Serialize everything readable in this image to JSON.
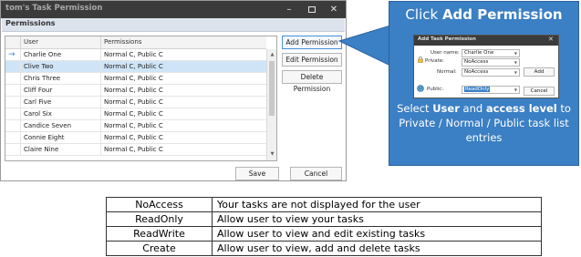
{
  "window": {
    "title": "tom's Task Permission",
    "minimize_glyph": "–",
    "close_glyph": "✕"
  },
  "group": {
    "label": "Permissions"
  },
  "grid": {
    "columns": [
      "User",
      "Permissions"
    ],
    "rows": [
      {
        "user": "Charlie One",
        "permissions": "Normal C, Public C",
        "current": true
      },
      {
        "user": "Clive Two",
        "permissions": "Normal C, Public C",
        "selected": true
      },
      {
        "user": "Chris Three",
        "permissions": "Normal C, Public C"
      },
      {
        "user": "Cliff Four",
        "permissions": "Normal C, Public C"
      },
      {
        "user": "Carl Five",
        "permissions": "Normal C, Public C"
      },
      {
        "user": "Carol Six",
        "permissions": "Normal C, Public C"
      },
      {
        "user": "Candice Seven",
        "permissions": "Normal C, Public C"
      },
      {
        "user": "Connie Eight",
        "permissions": "Normal C, Public C"
      },
      {
        "user": "Claire Nine",
        "permissions": "Normal C, Public C"
      }
    ],
    "current_row_marker": "→"
  },
  "buttons": {
    "add_permission": "Add Permission",
    "edit_permission": "Edit Permission",
    "delete_permission": "Delete Permission",
    "save": "Save",
    "cancel": "Cancel"
  },
  "callout": {
    "heading_prefix": "Click ",
    "heading_bold": "Add Permission",
    "desc_1": "Select ",
    "desc_user": "User",
    "desc_2": " and ",
    "desc_level": "access level",
    "desc_3": " to Private / Normal / Public task list entries",
    "background_color": "#3b7fc4"
  },
  "mini_dialog": {
    "title": "Add Task Permission",
    "close_glyph": "✕",
    "user_label": "User name:",
    "user_value": "Charlie One",
    "private_label": "Private:",
    "private_value": "NoAccess",
    "normal_label": "Normal:",
    "normal_value": "NoAccess",
    "public_label": "Public:",
    "public_value": "ReadOnly",
    "add_label": "Add",
    "cancel_label": "Cancel"
  },
  "legend": [
    {
      "level": "NoAccess",
      "description": "Your tasks are not displayed for the user"
    },
    {
      "level": "ReadOnly",
      "description": "Allow user to view your tasks"
    },
    {
      "level": "ReadWrite",
      "description": "Allow user to view and edit existing tasks"
    },
    {
      "level": "Create",
      "description": "Allow user to view, add and delete tasks"
    }
  ]
}
